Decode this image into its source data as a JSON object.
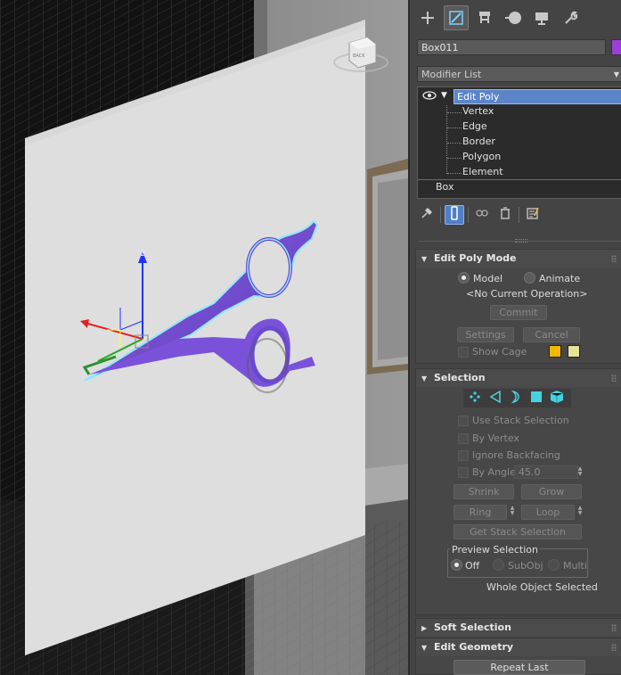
{
  "panel": {
    "tabs": [
      {
        "name": "create",
        "icon": "plus-icon"
      },
      {
        "name": "modify",
        "icon": "modify-icon"
      },
      {
        "name": "hierarchy",
        "icon": "hierarchy-icon"
      },
      {
        "name": "motion",
        "icon": "motion-icon"
      },
      {
        "name": "display",
        "icon": "display-icon"
      },
      {
        "name": "utilities",
        "icon": "wrench-icon"
      }
    ],
    "active_tab": "modify",
    "object_name": "Box011",
    "object_color": "#9c3fd6",
    "modifier_list_label": "Modifier List"
  },
  "stack": {
    "modifier": "Edit Poly",
    "subobjects": [
      "Vertex",
      "Edge",
      "Border",
      "Polygon",
      "Element"
    ],
    "base": "Box"
  },
  "edit_poly_mode": {
    "title": "Edit Poly Mode",
    "model_label": "Model",
    "animate_label": "Animate",
    "selected_mode": "Model",
    "operation": "<No Current Operation>",
    "commit_label": "Commit",
    "settings_label": "Settings",
    "cancel_label": "Cancel",
    "show_cage_label": "Show Cage",
    "cage_colors": [
      "#f2b705",
      "#e8e39a"
    ]
  },
  "selection": {
    "title": "Selection",
    "use_stack_selection": "Use Stack Selection",
    "by_vertex": "By Vertex",
    "ignore_backfacing": "Ignore Backfacing",
    "by_angle": "By Angle:",
    "angle_value": "45.0",
    "shrink": "Shrink",
    "grow": "Grow",
    "ring": "Ring",
    "loop": "Loop",
    "get_stack_selection": "Get Stack Selection",
    "preview_selection": "Preview Selection",
    "preview_off": "Off",
    "preview_subobj": "SubObj",
    "preview_multi": "Multi",
    "status": "Whole Object Selected"
  },
  "rollouts": {
    "soft_selection": "Soft Selection",
    "edit_geometry": "Edit Geometry",
    "repeat_last": "Repeat Last"
  },
  "viewcube": {
    "label": "BACK"
  }
}
